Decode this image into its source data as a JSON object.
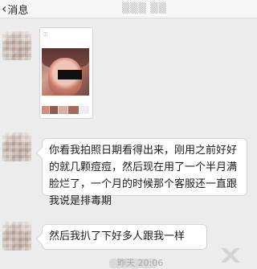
{
  "navbar": {
    "back_label": "消息",
    "title": "▒▒▒ ▒▒"
  },
  "messages": [
    {
      "sender": "contact",
      "type": "image"
    },
    {
      "sender": "contact",
      "type": "text",
      "text": "你看我拍照日期看得出来，刚用之前好好的就几颗痘痘，然后现在用了一个半月满脸烂了，一个月的时候那个客服还一直跟我说是排毒期"
    },
    {
      "sender": "contact",
      "type": "text",
      "text": "然后我扒了下好多人跟我一样"
    }
  ],
  "footer": {
    "time_text": "昨天 20:06"
  },
  "colors": {
    "background": "#ececec",
    "bubble": "#ffffff",
    "navbar": "#f7f7f7"
  }
}
